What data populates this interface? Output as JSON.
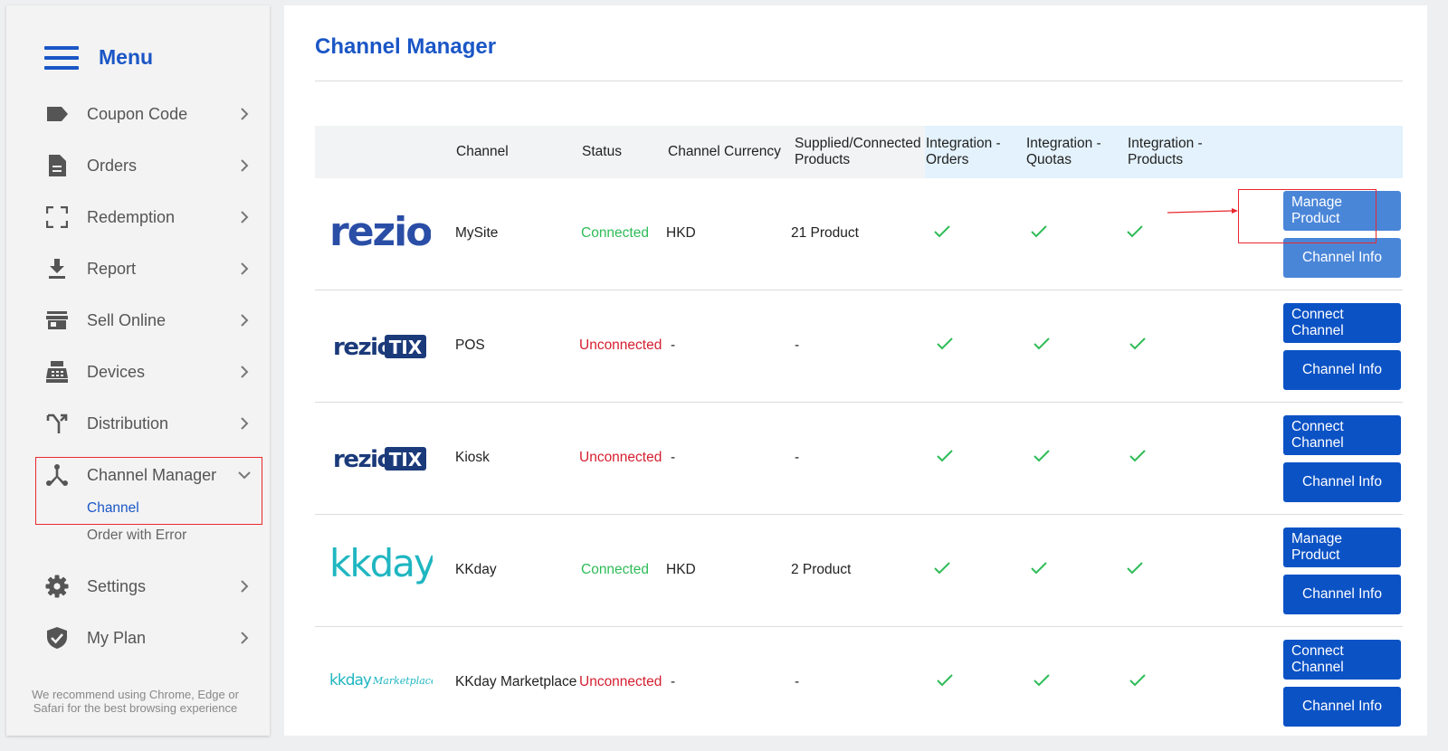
{
  "sidebar": {
    "menu_title": "Menu",
    "items": [
      {
        "label": "Coupon Code",
        "icon": "tag-icon"
      },
      {
        "label": "Orders",
        "icon": "document-icon"
      },
      {
        "label": "Redemption",
        "icon": "scan-icon"
      },
      {
        "label": "Report",
        "icon": "download-icon"
      },
      {
        "label": "Sell Online",
        "icon": "store-icon"
      },
      {
        "label": "Devices",
        "icon": "pos-device-icon"
      },
      {
        "label": "Distribution",
        "icon": "fork-icon"
      },
      {
        "label": "Channel Manager",
        "icon": "channel-network-icon",
        "expanded": true,
        "subitems": [
          "Channel",
          "Order with Error"
        ],
        "active_subitem": "Channel"
      },
      {
        "label": "Settings",
        "icon": "gear-icon"
      },
      {
        "label": "My Plan",
        "icon": "shield-check-icon"
      }
    ],
    "browser_note": "We recommend using Chrome, Edge or Safari for the best browsing experience"
  },
  "page": {
    "title": "Channel Manager"
  },
  "table": {
    "headers": {
      "channel": "Channel",
      "status": "Status",
      "currency": "Channel Currency",
      "products_line1": "Supplied/Connected",
      "products_line2": "Products",
      "int_orders_line1": "Integration -",
      "int_orders_line2": "Orders",
      "int_quotas_line1": "Integration -",
      "int_quotas_line2": "Quotas",
      "int_products_line1": "Integration -",
      "int_products_line2": "Products"
    },
    "rows": [
      {
        "logo_text": "rezio",
        "channel": "MySite",
        "status": "Connected",
        "currency": "HKD",
        "products": "21 Product",
        "action_line1": "Manage",
        "action_line2": "Product",
        "info": "Channel Info"
      },
      {
        "logo_text": "rezio",
        "logo_badge": "TIX",
        "channel": "POS",
        "status": "Unconnected",
        "currency": "-",
        "products": "-",
        "action_line1": "Connect",
        "action_line2": "Channel",
        "info": "Channel Info"
      },
      {
        "logo_text": "rezio",
        "logo_badge": "TIX",
        "channel": "Kiosk",
        "status": "Unconnected",
        "currency": "-",
        "products": "-",
        "action_line1": "Connect",
        "action_line2": "Channel",
        "info": "Channel Info"
      },
      {
        "logo_text": "kkday",
        "channel": "KKday",
        "status": "Connected",
        "currency": "HKD",
        "products": "2 Product",
        "action_line1": "Manage",
        "action_line2": "Product",
        "info": "Channel Info"
      },
      {
        "logo_text": "kkday",
        "logo_sub": "Marketplace",
        "channel": "KKday Marketplace",
        "status": "Unconnected",
        "currency": "-",
        "products": "-",
        "action_line1": "Connect",
        "action_line2": "Channel",
        "info": "Channel Info"
      }
    ]
  },
  "colors": {
    "brand_blue": "#1a56c6",
    "button_blue": "#0b52c5",
    "connected_green": "#2ebc57",
    "unconnected_red": "#d51e2f",
    "highlight_red": "#e8282e",
    "rezio_blue": "#2a4ea6",
    "kkday_teal": "#1fb6c1"
  }
}
